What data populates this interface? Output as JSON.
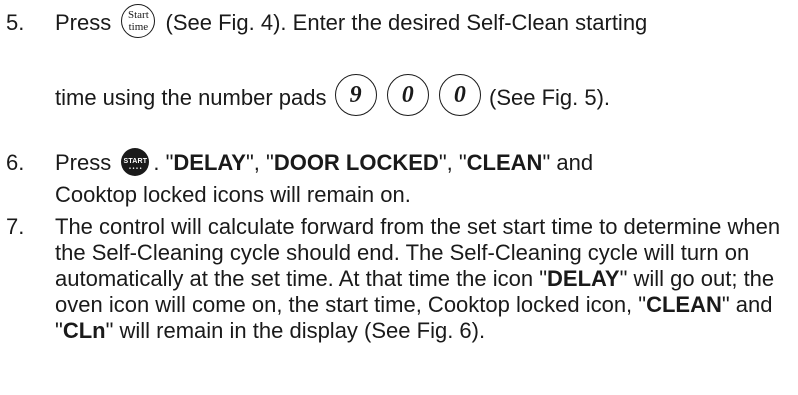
{
  "steps": [
    {
      "number": "5.",
      "line1": {
        "before": "Press",
        "button": {
          "top": "Start",
          "bottom": "time"
        },
        "after": "(See Fig. 4).  Enter the desired Self-Clean starting"
      },
      "line2": {
        "before": "time using the number pads",
        "pads": [
          "9",
          "0",
          "0"
        ],
        "after": "(See Fig. 5)."
      }
    },
    {
      "number": "6.",
      "line1": {
        "before": "Press",
        "button_label": "START",
        "t1": ". \"",
        "b1": "DELAY",
        "t2": "\", \"",
        "b2": "DOOR LOCKED",
        "t3": "\",  \"",
        "b3": "CLEAN",
        "t4": "\" and"
      },
      "line2": "Cooktop locked icons will remain on."
    },
    {
      "number": "7.",
      "p1": "The control will calculate forward from the set start time to determine when the Self-Cleaning cycle should end. The Self-Cleaning cycle will turn on automatically at the set time. At that time the icon \"",
      "b1": "DELAY",
      "p2": "\" will go out; the oven icon will come on, the start time, Cooktop locked icon, \"",
      "b2": "CLEAN",
      "p3": "\" and \"",
      "b3": "CLn",
      "p4": "\" will remain  in the display (See Fig. 6)."
    }
  ],
  "colors": {
    "text": "#1a1a1a",
    "background": "#ffffff"
  },
  "icons": [
    "start-time-button-icon",
    "number-pad-icon",
    "start-button-icon"
  ]
}
